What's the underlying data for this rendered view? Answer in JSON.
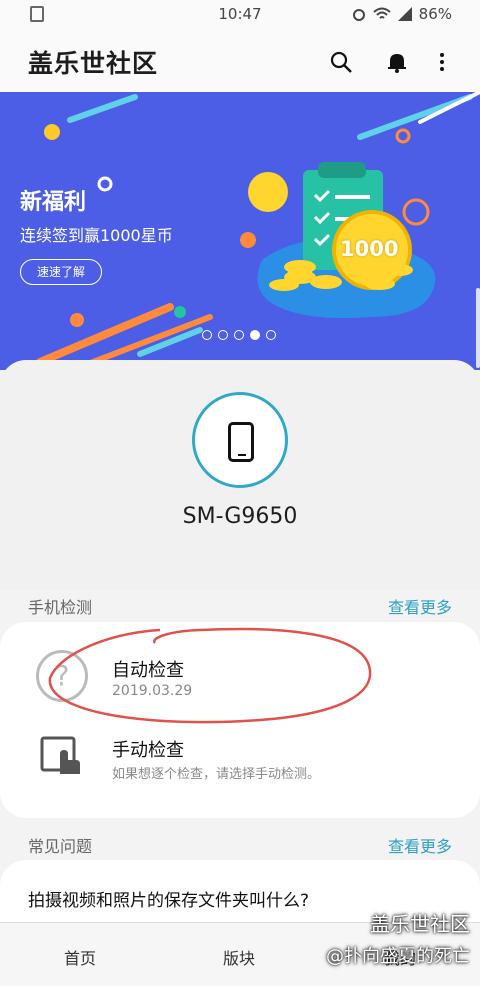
{
  "status": {
    "time": "10:47",
    "battery": "86%"
  },
  "appbar": {
    "title": "盖乐世社区"
  },
  "banner": {
    "headline": "新福利",
    "subtitle": "连续签到赢1000星币",
    "button": "速速了解",
    "coin": "1000"
  },
  "device": {
    "model": "SM-G9650"
  },
  "check_section": {
    "title": "手机检测",
    "more": "查看更多",
    "items": [
      {
        "title": "自动检查",
        "sub": "2019.03.29"
      },
      {
        "title": "手动检查",
        "sub": "如果想逐个检查，请选择手动检测。"
      }
    ]
  },
  "faq_section": {
    "title": "常见问题",
    "more": "查看更多",
    "first_question": "拍摄视频和照片的保存文件夹叫什么?"
  },
  "bottom_nav": {
    "tabs": [
      "首页",
      "版块",
      "我的"
    ]
  },
  "watermark": {
    "line1": "盖乐世社区",
    "line2": "@扑向盛夏的死亡"
  },
  "colors": {
    "accent": "#2f9fc4",
    "banner": "#4c5ee6",
    "annotation": "#e0524a"
  }
}
